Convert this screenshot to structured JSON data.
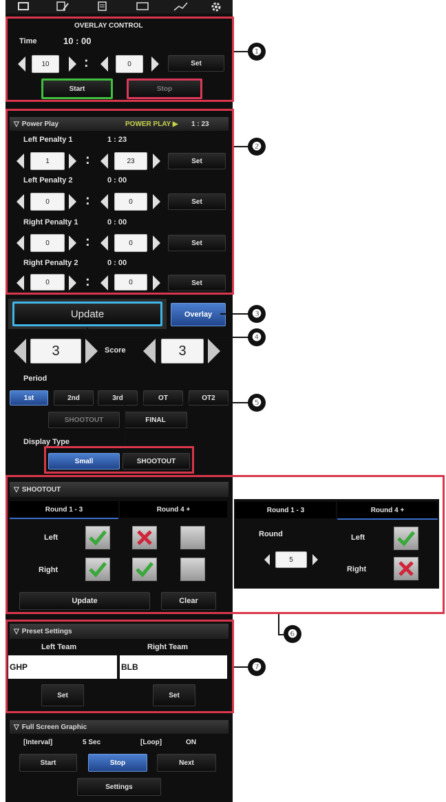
{
  "toolbar": {
    "icons": [
      "screen-icon",
      "edit-icon",
      "notes-icon",
      "display-icon",
      "signal-icon",
      "gear-icon"
    ]
  },
  "overlay": {
    "title": "OVERLAY CONTROL",
    "time_label": "Time",
    "time_value": "10 : 00",
    "min": "10",
    "sec": "0",
    "set": "Set",
    "start": "Start",
    "stop": "Stop"
  },
  "powerplay": {
    "header": "Power Play",
    "status": "POWER PLAY ▶",
    "status_time": "1 : 23",
    "rows": [
      {
        "label": "Left Penalty 1",
        "time": "1 : 23",
        "min": "1",
        "sec": "23",
        "set": "Set"
      },
      {
        "label": "Left Penalty 2",
        "time": "0 : 00",
        "min": "0",
        "sec": "0",
        "set": "Set"
      },
      {
        "label": "Right Penalty 1",
        "time": "0 : 00",
        "min": "0",
        "sec": "0",
        "set": "Set"
      },
      {
        "label": "Right Penalty 2",
        "time": "0 : 00",
        "min": "0",
        "sec": "0",
        "set": "Set"
      }
    ]
  },
  "update_button": "Update",
  "overlay_button": "Overlay",
  "score": {
    "label": "Score",
    "left": "3",
    "right": "3"
  },
  "period": {
    "label": "Period",
    "buttons": [
      "1st",
      "2nd",
      "3rd",
      "OT",
      "OT2"
    ],
    "shootout": "SHOOTOUT",
    "final": "FINAL"
  },
  "display_type": {
    "label": "Display Type",
    "small": "Small",
    "shootout": "SHOOTOUT"
  },
  "shootout": {
    "header": "SHOOTOUT",
    "tabs": [
      "Round 1 - 3",
      "Round 4 +"
    ],
    "left_label": "Left",
    "right_label": "Right",
    "left": [
      "check",
      "cross",
      "empty"
    ],
    "right": [
      "check",
      "check",
      "empty"
    ],
    "update": "Update",
    "clear": "Clear"
  },
  "shootout_alt": {
    "tabs": [
      "Round 1 - 3",
      "Round 4 +"
    ],
    "round_label": "Round",
    "round_value": "5",
    "left_label": "Left",
    "right_label": "Right",
    "left": "check",
    "right": "cross"
  },
  "preset": {
    "header": "Preset Settings",
    "left_team_label": "Left Team",
    "right_team_label": "Right Team",
    "left_team": "GHP",
    "right_team": "BLB",
    "set": "Set"
  },
  "fullscreen": {
    "header": "Full Screen Graphic",
    "interval_label": "[Interval]",
    "interval_value": "5 Sec",
    "loop_label": "[Loop]",
    "loop_value": "ON",
    "start": "Start",
    "stop": "Stop",
    "next": "Next",
    "settings": "Settings"
  },
  "callouts": [
    "❶",
    "❷",
    "❸",
    "❹",
    "❺",
    "❻",
    "❼"
  ],
  "colors": {
    "highlight_red": "#d9364b",
    "start_green": "#3fbf3f",
    "stop_red": "#d93a5a",
    "update_cyan": "#3fb6e8",
    "accent_blue": "#3a6fc9",
    "status_yellow": "#c8d24a"
  }
}
